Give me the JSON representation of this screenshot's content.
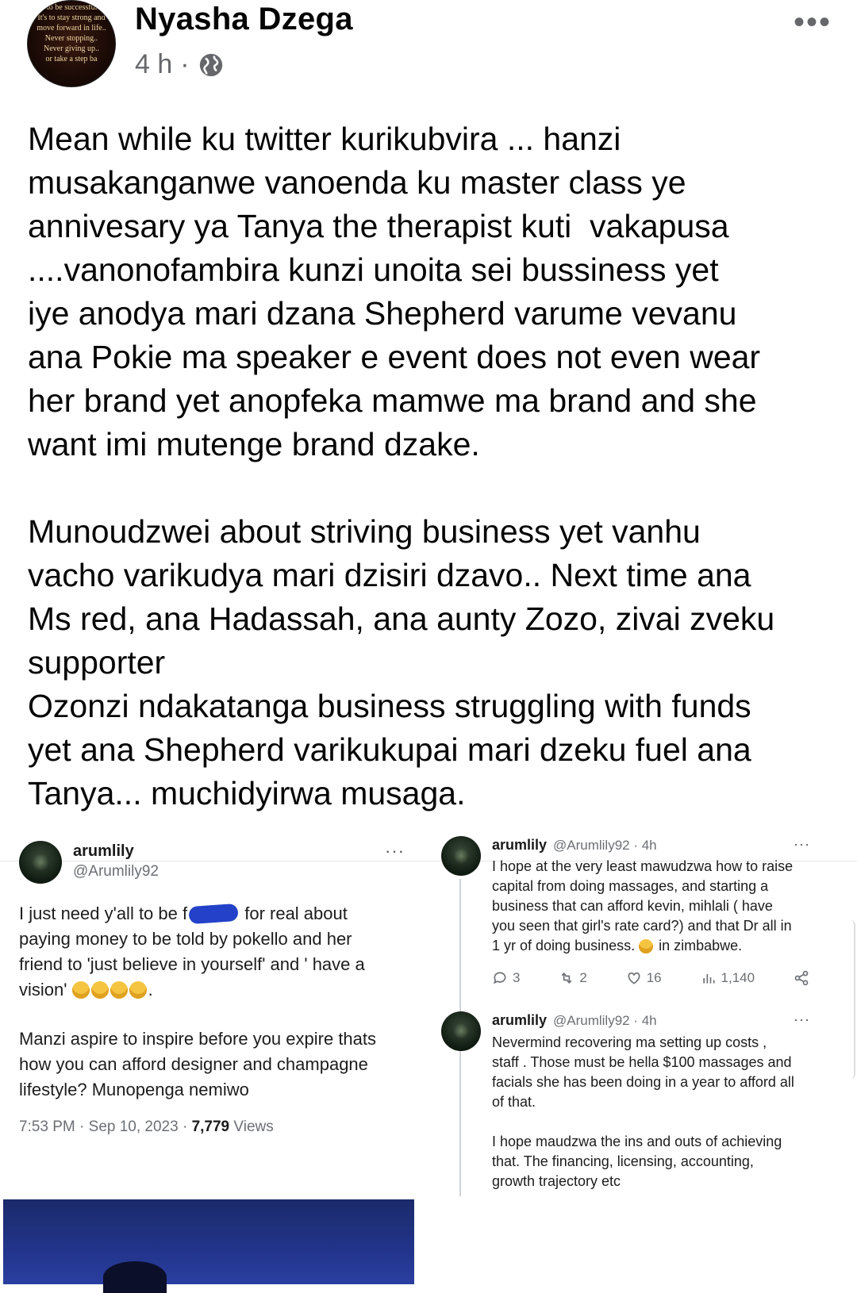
{
  "post": {
    "author": "Nyasha Dzega",
    "time": "4 h",
    "separator": "·",
    "audience_icon": "globe-icon",
    "more_icon": "more-horizontal-icon",
    "avatar_text": "s to be successful..\nIt's to stay strong and\nmove forward in life..\nNever stopping..\nNever giving up..\nor take a step ba",
    "text": "Mean while ku twitter kurikubvira ... hanzi\nmusakanganwe vanoenda ku master class ye\nannivesary ya Tanya the therapist kuti  vakapusa\n....vanonofambira kunzi unoita sei bussiness yet\niye anodya mari dzana Shepherd varume vevanu\nana Pokie ma speaker e event does not even wear\nher brand yet anopfeka mamwe ma brand and she\nwant imi mutenge brand dzake.\n\nMunoudzwei about striving business yet vanhu\nvacho varikudya mari dzisiri dzavo.. Next time ana\nMs red, ana Hadassah, ana aunty Zozo, zivai zveku\nsupporter\nOzonzi ndakatanga business struggling with funds\nyet ana Shepherd varikukupai mari dzeku fuel ana\nTanya... muchidyirwa musaga."
  },
  "tweet_left": {
    "name": "arumlily",
    "handle": "@Arumlily92",
    "text_a": "I just need y'all to be f",
    "text_b": " for real about\npaying money to be told by pokello and her\nfriend to 'just believe in yourself' and ' have a\nvision' ",
    "emojis": "😂😂😂😂",
    "text_c": ".",
    "text2": "Manzi aspire to inspire before you expire thats\nhow you can afford designer and champagne\nlifestyle? Munopenga nemiwo",
    "date": "7:53 PM · Sep 10, 2023 · ",
    "views": "7,779",
    "views_label": " Views"
  },
  "tweet_right_1": {
    "name": "arumlily",
    "handle": "@Arumlily92 · 4h",
    "text": "I hope at the very least mawudzwa how to raise\ncapital from doing massages, and starting a\nbusiness that can afford kevin, mihlali ( have\nyou seen that girl's rate card?) and that Dr all in\n1 yr of doing business. ",
    "text_end": " in zimbabwe.",
    "replies": "3",
    "retweets": "2",
    "likes": "16",
    "views": "1,140"
  },
  "tweet_right_2": {
    "name": "arumlily",
    "handle": "@Arumlily92 · 4h",
    "text": "Nevermind recovering ma setting up costs ,\nstaff . Those must be hella $100 massages and\nfacials she has been doing in a year to afford all\nof that.\n\nI hope maudzwa the ins and outs of achieving\nthat. The financing, licensing, accounting,\ngrowth trajectory etc"
  }
}
